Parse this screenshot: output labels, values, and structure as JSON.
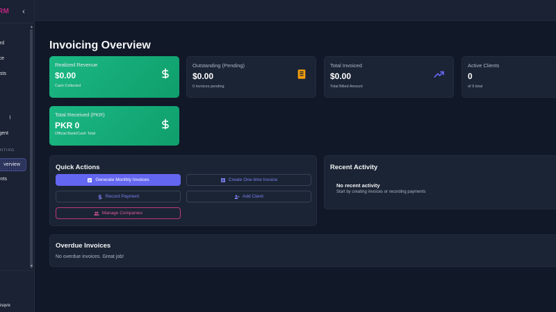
{
  "sidebar": {
    "brand": "RM",
    "collapse_icon": "chevron-left-icon",
    "items": [
      {
        "label": "rd"
      },
      {
        "label": "ce"
      },
      {
        "label": "sts"
      },
      {
        "label": "l"
      },
      {
        "label": "agent"
      }
    ],
    "section_label": "NTING",
    "active_item": {
      "label": "verview"
    },
    "after_items": [
      {
        "label": "ents"
      }
    ],
    "user_name": "isqvix"
  },
  "page": {
    "title": "Invoicing Overview"
  },
  "stats": [
    {
      "label": "Realized Revenue",
      "value": "$0.00",
      "sub": "Cash Collected",
      "icon": "dollar-icon",
      "style": "green"
    },
    {
      "label": "Outstanding (Pending)",
      "value": "$0.00",
      "sub": "0 invoices pending",
      "icon": "receipt-icon",
      "style": "dark",
      "icon_color": "#f59e0b"
    },
    {
      "label": "Total Invoiced",
      "value": "$0.00",
      "sub": "Total Billed Amount",
      "icon": "trending-up-icon",
      "style": "dark",
      "icon_color": "#6366f1"
    },
    {
      "label": "Active Clients",
      "value": "0",
      "sub": "of 9 total",
      "icon": "users-icon",
      "style": "dark"
    },
    {
      "label": "Total Received (PKR)",
      "value": "PKR 0",
      "sub": "Official Bank/Cash Total",
      "icon": "dollar-icon",
      "style": "green"
    }
  ],
  "quick_actions": {
    "title": "Quick Actions",
    "buttons": [
      {
        "label": "Generate Monthly Invoices",
        "icon": "invoice-icon"
      },
      {
        "label": "Create One-time Invoice",
        "icon": "invoice-icon"
      },
      {
        "label": "Record Payment",
        "icon": "dollar-icon"
      },
      {
        "label": "Add Client",
        "icon": "user-plus-icon"
      },
      {
        "label": "Manage Companies",
        "icon": "users-icon"
      }
    ]
  },
  "recent_activity": {
    "title": "Recent Activity",
    "empty_title": "No recent activity",
    "empty_sub": "Start by creating invoices or recording payments"
  },
  "overdue": {
    "title": "Overdue Invoices",
    "message": "No overdue invoices. Great job!"
  },
  "colors": {
    "background": "#111827",
    "panel": "#1b2434",
    "green": "#10b981",
    "accent": "#6366f1",
    "pink": "#e25a9c",
    "warning": "#f59e0b"
  }
}
